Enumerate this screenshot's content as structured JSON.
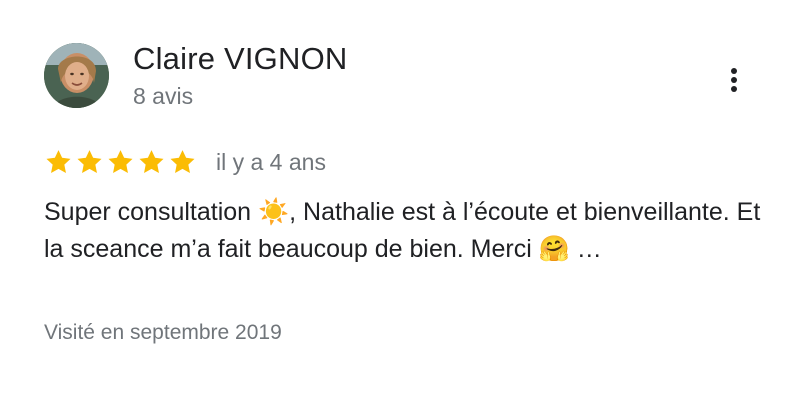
{
  "review": {
    "author_name": "Claire VIGNON",
    "review_count_label": "8 avis",
    "rating": 5,
    "max_rating": 5,
    "date_label": "il y a 4 ans",
    "text": "Super consultation ☀️, Nathalie est à l’écoute et bienveillante. Et la sceance m’a fait beaucoup de bien. Merci 🤗 …",
    "visited_label": "Visité en septembre 2019"
  },
  "icons": {
    "avatar": "person-photo",
    "more": "more-vertical-icon",
    "star": "star-icon"
  },
  "colors": {
    "star": "#fbbc04",
    "name": "#202124",
    "secondary": "#70757a"
  }
}
